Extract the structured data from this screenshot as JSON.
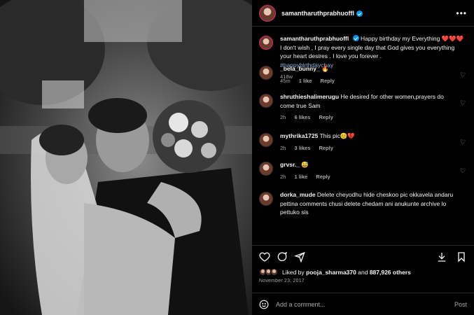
{
  "post": {
    "username": "samantharuthprabhuoffl",
    "more_label": "•••"
  },
  "caption": {
    "username": "samantharuthprabhuoffl",
    "text": "Happy birthday my Everything ❤️❤️❤️ I don't wish , I pray every single day that God gives you everything your heart desires . I love you forever .",
    "hashtag": "#happybirthdaychay",
    "time": "418w"
  },
  "comments": [
    {
      "username": "_bela_bunny_",
      "text": "🔥",
      "time": "45m",
      "likes": "1 like",
      "reply": "Reply"
    },
    {
      "username": "shruthieshalimerugu",
      "text": "He desired for other women,prayers do come true Sam",
      "time": "2h",
      "likes": "6 likes",
      "reply": "Reply"
    },
    {
      "username": "mythrika1725",
      "text": "This pic😊💔",
      "time": "2h",
      "likes": "3 likes",
      "reply": "Reply"
    },
    {
      "username": "grvsr._",
      "text": "😅",
      "time": "2h",
      "likes": "1 like",
      "reply": "Reply"
    },
    {
      "username": "dorka_mude",
      "text": "Delete cheyodhu hide cheskoo pic okkavela andaru pettina comments chusi delete chedam ani anukunte archive lo pettuko sis",
      "time": "",
      "likes": "",
      "reply": ""
    }
  ],
  "likes": {
    "prefix": "Liked by",
    "user": "pooja_sharma370",
    "joiner": "and",
    "others": "887,926 others"
  },
  "date": "November 23, 2017",
  "add_comment": {
    "placeholder": "Add a comment...",
    "post_label": "Post"
  },
  "icons": [
    "heart-icon",
    "comment-icon",
    "share-icon",
    "download-icon",
    "bookmark-icon",
    "emoji-icon",
    "verified-icon"
  ]
}
